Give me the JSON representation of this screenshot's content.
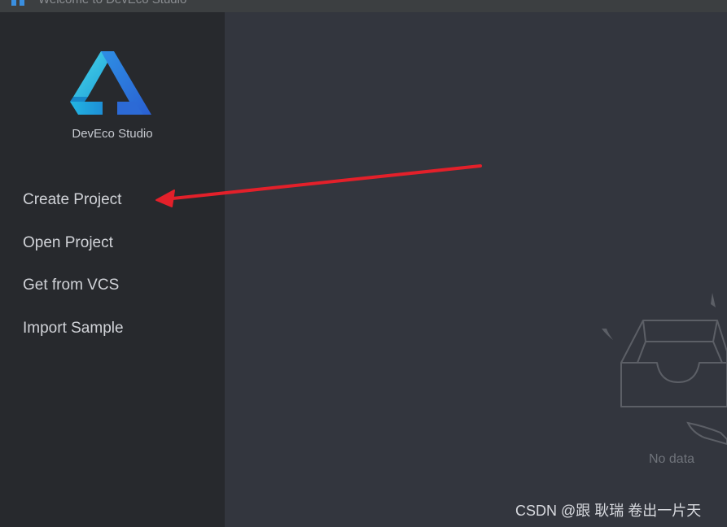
{
  "window": {
    "title": "Welcome to DevEco Studio"
  },
  "sidebar": {
    "product_name": "DevEco Studio",
    "items": [
      {
        "label": "Create Project",
        "icon": "none"
      },
      {
        "label": "Open Project",
        "icon": "none"
      },
      {
        "label": "Get from VCS",
        "icon": "none"
      },
      {
        "label": "Import Sample",
        "icon": "none"
      }
    ]
  },
  "main": {
    "empty_state_text": "No data",
    "empty_state_icon": "empty-inbox-icon"
  },
  "annotation": {
    "arrow_color": "#e3202a",
    "target": "Create Project"
  },
  "watermark": {
    "text": "CSDN @跟 耿瑞 卷出一片天"
  },
  "colors": {
    "sidebar_bg": "#27292d",
    "main_bg": "#33363e",
    "logo_light": "#3fd0e8",
    "logo_dark": "#2f6fe0"
  }
}
